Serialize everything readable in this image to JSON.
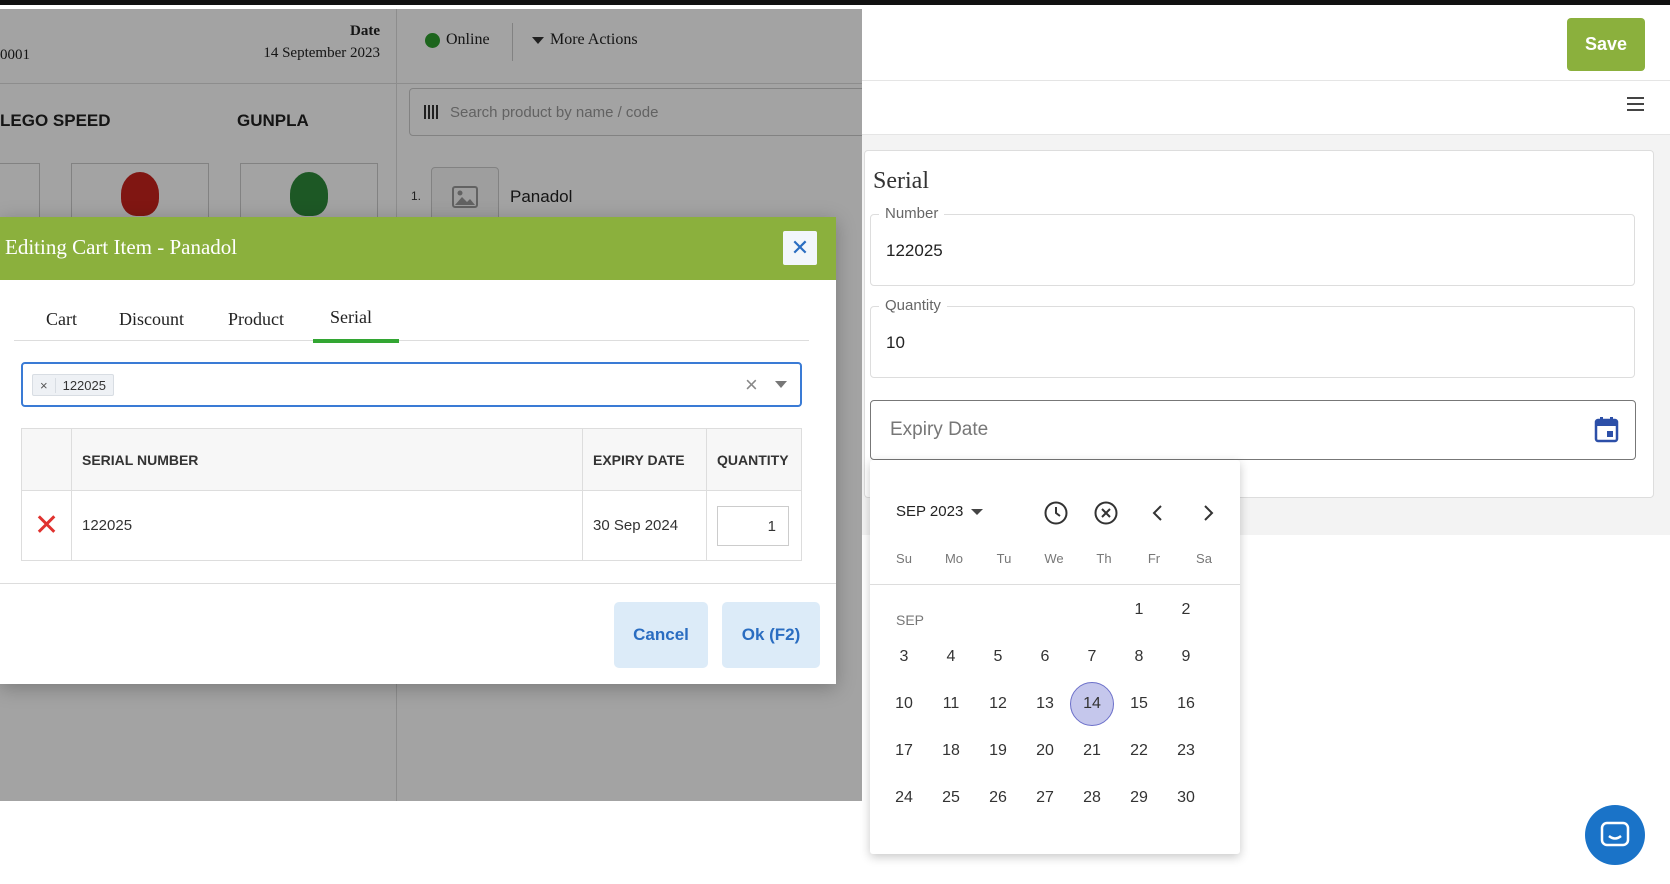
{
  "pos": {
    "invoice_fragment": "0001",
    "date_label": "Date",
    "date_value": "14 September 2023",
    "categories": [
      "LEGO SPEED",
      "GUNPLA"
    ],
    "status": "Online",
    "more_actions": "More Actions",
    "search_placeholder": "Search product by name / code",
    "line_number": "1.",
    "line_product": "Panadol"
  },
  "modal": {
    "title": "Editing Cart Item - Panadol",
    "close": "✕",
    "tabs": [
      "Cart",
      "Discount",
      "Product",
      "Serial"
    ],
    "active_tab": "Serial",
    "selected_chip": "122025",
    "chip_remove": "×",
    "clear": "×",
    "table": {
      "headers": [
        "SERIAL NUMBER",
        "EXPIRY DATE",
        "QUANTITY"
      ],
      "rows": [
        {
          "delete": "✕",
          "serial": "122025",
          "expiry": "30 Sep 2024",
          "quantity": "1"
        }
      ]
    },
    "cancel": "Cancel",
    "ok": "Ok (F2)"
  },
  "right": {
    "save": "Save",
    "section_title": "Serial",
    "number_label": "Number",
    "number_value": "122025",
    "quantity_label": "Quantity",
    "quantity_value": "10",
    "expiry_placeholder": "Expiry Date"
  },
  "calendar": {
    "month_year": "SEP 2023",
    "month_short": "SEP",
    "weekdays": [
      "Su",
      "Mo",
      "Tu",
      "We",
      "Th",
      "Fr",
      "Sa"
    ],
    "first_weekday_index": 5,
    "days_in_month": 30,
    "selected_day": 14
  },
  "colors": {
    "brand_green": "#8bb03d",
    "tab_active": "#33a633",
    "link_blue": "#2a6dc1",
    "delete_red": "#e0322f",
    "selected_day": "#c5c7ec"
  }
}
